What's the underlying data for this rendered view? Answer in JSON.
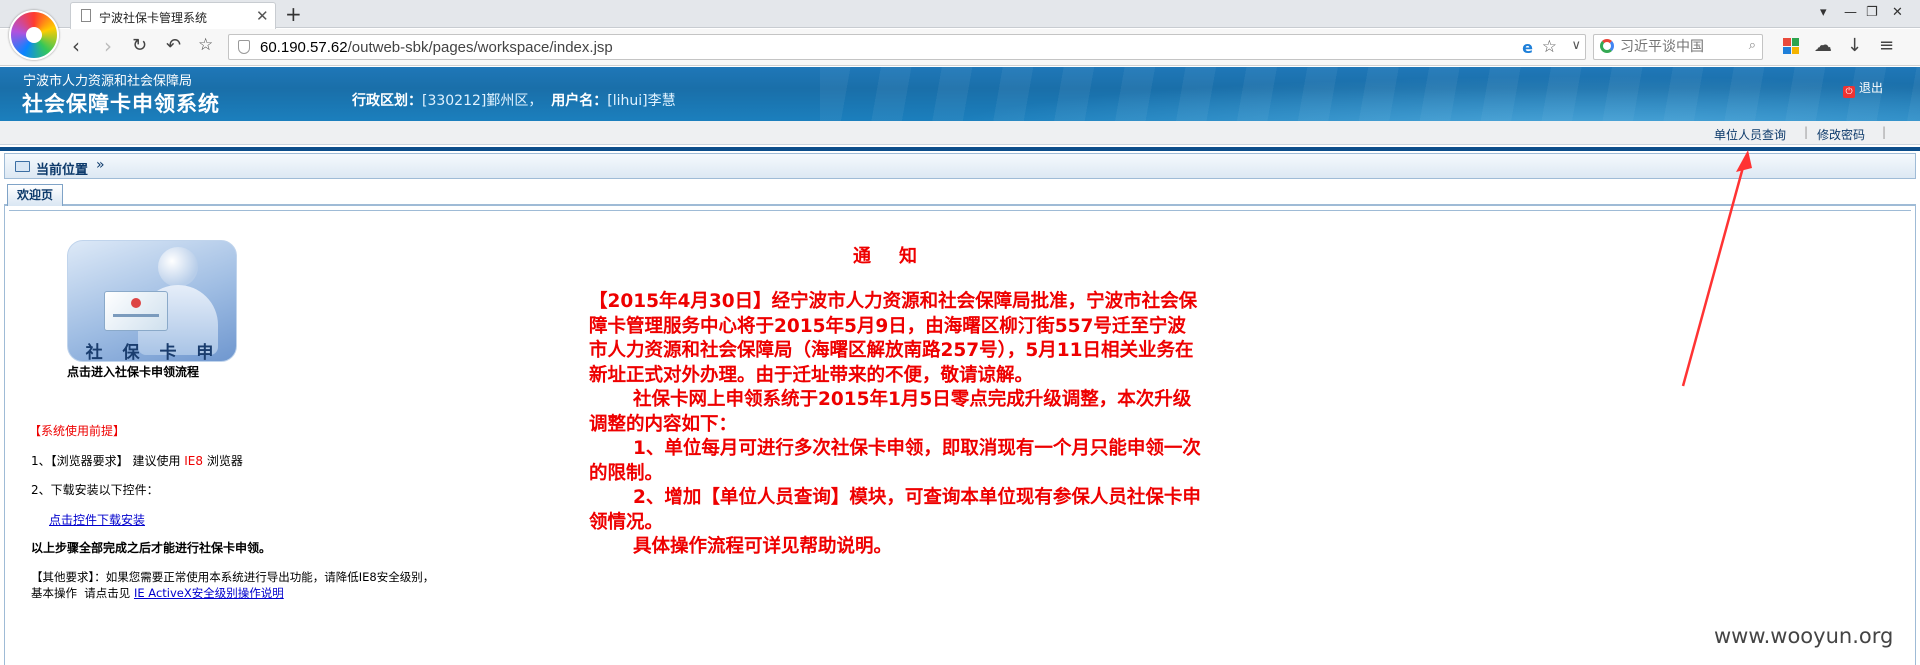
{
  "browser": {
    "tab_title": "宁波社保卡管理系统",
    "url_host": "60.190.57.62",
    "url_path": "/outweb-sbk/pages/workspace/index.jsp",
    "search_placeholder": "习近平谈中国"
  },
  "header": {
    "org_name": "宁波市人力资源和社会保障局",
    "system_name": "社会保障卡申领系统",
    "region_label": "行政区划：",
    "region_value": "[330212]鄞州区，",
    "user_label": "用户名：",
    "user_value": "[lihui]李慧",
    "logout_label": "退出"
  },
  "subnav": {
    "items": [
      "单位人员查询",
      "修改密码"
    ]
  },
  "breadcrumb": {
    "label": "当前位置",
    "arrows": "»"
  },
  "tabs": {
    "active": "欢迎页"
  },
  "left_panel": {
    "card_caption": "社 保 卡 申 领",
    "card_link": "点击进入社保卡申领流程",
    "prereq_title": "【系统使用前提】",
    "prereq_browser_prefix": "1、【浏览器要求】 建议使用 ",
    "prereq_browser_highlight": "IE8",
    "prereq_browser_suffix": " 浏览器",
    "prereq_controls": "2、下载安装以下控件：",
    "download_link": "点击控件下载安装",
    "steps_note": "以上步骤全部完成之后才能进行社保卡申领。",
    "other_req_line1": "【其他要求】：如果您需要正常使用本系统进行导出功能，请降低IE8安全级别，",
    "other_req_line2": "基本操作  请点击见 ",
    "other_req_link": "IE ActiveX安全级别操作说明"
  },
  "notice": {
    "title": "通知",
    "paragraphs": [
      "【2015年4月30日】经宁波市人力资源和社会保障局批准，宁波市社会保障卡管理服务中心将于2015年5月9日，由海曙区柳汀街557号迁至宁波市人力资源和社会保障局（海曙区解放南路257号），5月11日相关业务在新址正式对外办理。由于迁址带来的不便，敬请谅解。",
      "社保卡网上申领系统于2015年1月5日零点完成升级调整，本次升级调整的内容如下：",
      "1、单位每月可进行多次社保卡申领，即取消现有一个月只能申领一次的限制。",
      "2、增加【单位人员查询】模块，可查询本单位现有参保人员社保卡申领情况。",
      "具体操作流程可详见帮助说明。"
    ]
  },
  "watermark": "www.wooyun.org",
  "colors": {
    "notice_red": "#e00000",
    "header_blue": "#1a6fa9",
    "annotation_arrow": "#ff3333"
  }
}
